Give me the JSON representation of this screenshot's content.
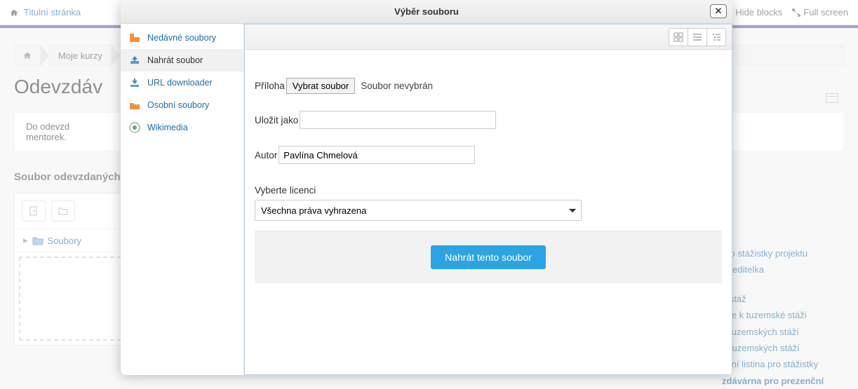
{
  "topbar": {
    "title_link": "Titulní stránka",
    "hide_blocks": "Hide blocks",
    "full_screen": "Full screen"
  },
  "breadcrumb": {
    "my_courses": "Moje kurzy"
  },
  "page": {
    "title_truncated": "Odevzdáv",
    "intro_line1": "Do odevzd",
    "intro_line2": "mentorek.",
    "section_title": "Soubor odevzdaných",
    "files_tree": "Soubory"
  },
  "right_links": [
    "pro stážistky projektu",
    "á ředitelka",
    "á stáž",
    "ace k tuzemské stáži",
    "s tuzemských stáží",
    "n tuzemských stáží",
    "nční listina pro stážistky",
    "zdávárna pro prezenční"
  ],
  "dialog": {
    "title": "Výběr souboru",
    "repos": {
      "recent": "Nedávné soubory",
      "upload": "Nahrát soubor",
      "url": "URL downloader",
      "private": "Osobní soubory",
      "wikimedia": "Wikimedia"
    },
    "form": {
      "attachment_label": "Příloha",
      "choose_file_btn": "Vybrat soubor",
      "no_file": "Soubor nevybrán",
      "save_as_label": "Uložit jako",
      "save_as_value": "",
      "author_label": "Autor",
      "author_value": "Pavlína Chmelová",
      "license_label": "Vyberte licenci",
      "license_selected": "Všechna práva vyhrazena",
      "submit": "Nahrát tento soubor"
    }
  }
}
